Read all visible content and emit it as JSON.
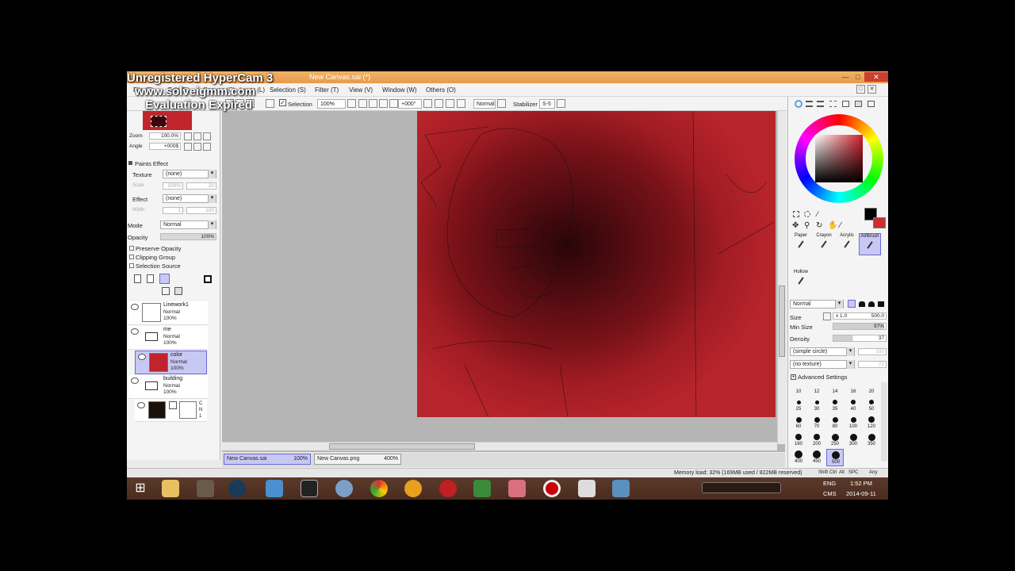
{
  "watermark": {
    "line1": "Unregistered HyperCam 3",
    "line2": "www.solveigmm.com",
    "line3": "Evaluation Expired"
  },
  "window": {
    "title": "New Canvas.sai (*)",
    "close_label": "✕",
    "maximize_label": "□",
    "minimize_label": "—"
  },
  "menu": {
    "items": [
      "File (F)",
      "Edit (E)",
      "Canvas (C)",
      "Layer (L)",
      "Selection (S)",
      "Filter (T)",
      "View (V)",
      "Window (W)",
      "Others (O)"
    ]
  },
  "toolbar": {
    "selection_label": "Selection",
    "zoom_value": "100%",
    "angle_value": "+000°",
    "blend_mode": "Normal",
    "stabilizer_label": "Stabilizer",
    "stabilizer_value": "S-5"
  },
  "navigator": {
    "zoom_label": "Zoom",
    "zoom_value": "100.0%",
    "angle_label": "Angle",
    "angle_value": "+000$"
  },
  "paints_effect": {
    "header": "Paints Effect",
    "texture_label": "Texture",
    "texture_value": "(none)",
    "scale_label": "Scale",
    "scale_value": "100%",
    "scale_num": "20",
    "effect_label": "Effect",
    "effect_value": "(none)",
    "width_label": "Width",
    "width_value": "1",
    "width_num": "100"
  },
  "layer_props": {
    "mode_label": "Mode",
    "mode_value": "Normal",
    "opacity_label": "Opacity",
    "opacity_value": "100%",
    "preserve_opacity": "Preserve Opacity",
    "clipping_group": "Clipping Group",
    "selection_source": "Selection Source"
  },
  "layers": [
    {
      "name": "Linework1",
      "mode": "Normal",
      "opacity": "100%",
      "type": "pen-layer",
      "selected": false
    },
    {
      "name": "me",
      "mode": "Normal",
      "opacity": "100%",
      "type": "folder",
      "selected": false
    },
    {
      "name": "color",
      "mode": "Normal",
      "opacity": "100%",
      "type": "red-thumb",
      "selected": true
    },
    {
      "name": "building",
      "mode": "Normal",
      "opacity": "100%",
      "type": "folder",
      "selected": false
    }
  ],
  "last_layer": {
    "c": "C",
    "n": "N",
    "one": "1"
  },
  "file_tabs": [
    {
      "name": "New Canvas.sai",
      "zoom": "100%",
      "active": true
    },
    {
      "name": "New Canvas.png",
      "zoom": "400%",
      "active": false
    }
  ],
  "tools": {
    "row1": [
      "Paper",
      "Crayon",
      "Acrylic",
      "AirBrush"
    ],
    "row2": [
      "Hollow"
    ]
  },
  "brush": {
    "mode": "Normal",
    "size_label": "Size",
    "size_mult": "x 1.0",
    "size_value": "500.0",
    "min_size_label": "Min Size",
    "min_size_value": "97%",
    "density_label": "Density",
    "density_value": "37",
    "shape": "(simple circle)",
    "shape_num": "100",
    "texture": "(no texture)",
    "texture_num": "72",
    "advanced": "Advanced Settings",
    "sizes": [
      "10",
      "12",
      "14",
      "16",
      "20",
      "25",
      "30",
      "35",
      "40",
      "50",
      "60",
      "70",
      "80",
      "100",
      "120",
      "160",
      "200",
      "250",
      "300",
      "350",
      "400",
      "450",
      "500"
    ]
  },
  "status": {
    "memory": "Memory load: 32% (169MB used / 822MB reserved)",
    "keys": [
      "Shift",
      "Ctrl",
      "Alt",
      "SPC",
      "Any"
    ]
  },
  "taskbar": {
    "lang": "ENG",
    "lang2": "CMS",
    "time": "1:52 PM",
    "date": "2014-09-11"
  },
  "colors": {
    "accent": "#6a6ad8",
    "canvas_red": "#b8242b",
    "taskbar": "#4a2c1f"
  }
}
